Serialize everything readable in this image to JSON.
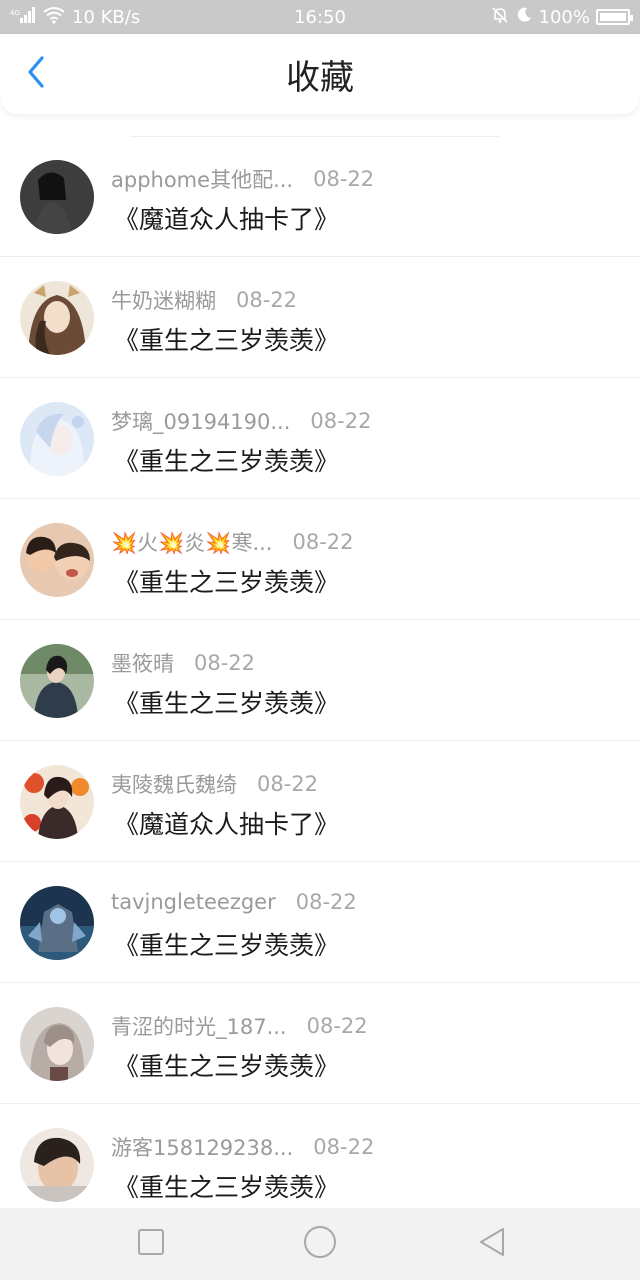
{
  "status_bar": {
    "signal": "4G",
    "net_speed": "10 KB/s",
    "time": "16:50",
    "battery": "100%",
    "icons": [
      "signal-icon",
      "wifi-icon",
      "bell-off-icon",
      "moon-icon",
      "battery-icon"
    ]
  },
  "header": {
    "title": "收藏",
    "back_icon": "chevron-left-icon",
    "accent": "#2b8ff0"
  },
  "favorites": [
    {
      "name": "apphome其他配...",
      "date": "08-22",
      "title": "《魔道众人抽卡了》",
      "avatar_color": "#222222"
    },
    {
      "name": "牛奶迷糊糊",
      "date": "08-22",
      "title": "《重生之三岁羡羡》",
      "avatar_color": "#8a6b4e"
    },
    {
      "name": "梦璃_09194190...",
      "date": "08-22",
      "title": "《重生之三岁羡羡》",
      "avatar_color": "#c9d8ee"
    },
    {
      "name": "💥火💥炎💥寒...",
      "date": "08-22",
      "title": "《重生之三岁羡羡》",
      "avatar_color": "#c98a6a"
    },
    {
      "name": "墨筱晴",
      "date": "08-22",
      "title": "《重生之三岁羡羡》",
      "avatar_color": "#3d5648"
    },
    {
      "name": "夷陵魏氏魏绮",
      "date": "08-22",
      "title": "《魔道众人抽卡了》",
      "avatar_color": "#c8442b"
    },
    {
      "name": "tavjngleteezger",
      "date": "08-22",
      "title": "《重生之三岁羡羡》",
      "avatar_color": "#2a4a6a"
    },
    {
      "name": "青涩的时光_187...",
      "date": "08-22",
      "title": "《重生之三岁羡羡》",
      "avatar_color": "#b8b0ac"
    },
    {
      "name": "游客158129238...",
      "date": "08-22",
      "title": "《重生之三岁羡羡》",
      "avatar_color": "#d9b8a0"
    }
  ],
  "nav_bar": {
    "icons": [
      "square-icon",
      "circle-icon",
      "triangle-back-icon"
    ]
  }
}
